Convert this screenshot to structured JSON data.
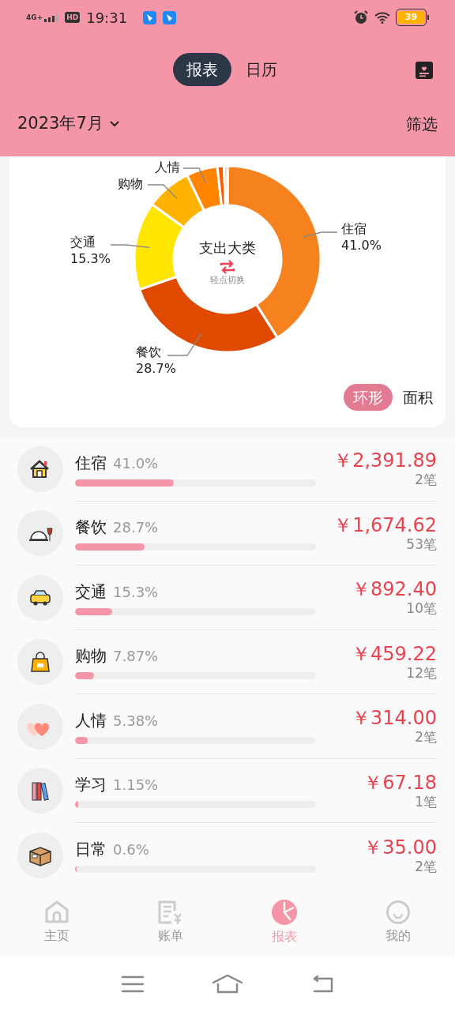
{
  "status_bar": {
    "network": "4G+",
    "hd": "HD",
    "time": "19:31",
    "battery": "39"
  },
  "header": {
    "tabs": [
      {
        "label": "报表",
        "selected": true
      },
      {
        "label": "日历",
        "selected": false
      }
    ],
    "month": "2023年7月",
    "filter": "筛选"
  },
  "chart": {
    "center_title": "支出大类",
    "center_hint": "轻点切换",
    "chart_data": {
      "type": "donut",
      "values": [
        41.0,
        28.7,
        15.3,
        7.87,
        5.38,
        1.15,
        0.6
      ],
      "colors": [
        "#f5821f",
        "#e04a00",
        "#ffe600",
        "#ffb300",
        "#ff8400",
        "#ff5a00",
        "#ffc080"
      ]
    },
    "callouts": [
      {
        "name": "住宿",
        "percent": "41.0%"
      },
      {
        "name": "餐饮",
        "percent": "28.7%"
      },
      {
        "name": "交通",
        "percent": "15.3%"
      },
      {
        "name": "购物"
      },
      {
        "name": "人情"
      }
    ],
    "modes": [
      {
        "label": "环形",
        "selected": true
      },
      {
        "label": "面积",
        "selected": false
      }
    ]
  },
  "categories": [
    {
      "kind": "house",
      "name": "住宿",
      "percent": "41.0%",
      "level": 0.41,
      "amount": "￥2,391.89",
      "count": "2笔"
    },
    {
      "kind": "dining",
      "name": "餐饮",
      "percent": "28.7%",
      "level": 0.287,
      "amount": "￥1,674.62",
      "count": "53笔"
    },
    {
      "kind": "taxi",
      "name": "交通",
      "percent": "15.3%",
      "level": 0.153,
      "amount": "￥892.40",
      "count": "10笔"
    },
    {
      "kind": "bag",
      "name": "购物",
      "percent": "7.87%",
      "level": 0.0787,
      "amount": "￥459.22",
      "count": "12笔"
    },
    {
      "kind": "hearts",
      "name": "人情",
      "percent": "5.38%",
      "level": 0.0538,
      "amount": "￥314.00",
      "count": "2笔"
    },
    {
      "kind": "books",
      "name": "学习",
      "percent": "1.15%",
      "level": 0.0115,
      "amount": "￥67.18",
      "count": "1笔"
    },
    {
      "kind": "box",
      "name": "日常",
      "percent": "0.6%",
      "level": 0.006,
      "amount": "￥35.00",
      "count": "2笔"
    }
  ],
  "bottom_nav": [
    {
      "kind": "home",
      "label": "主页",
      "selected": false
    },
    {
      "kind": "bill",
      "label": "账单",
      "selected": false
    },
    {
      "kind": "report",
      "label": "报表",
      "selected": true
    },
    {
      "kind": "me",
      "label": "我的",
      "selected": false
    }
  ]
}
